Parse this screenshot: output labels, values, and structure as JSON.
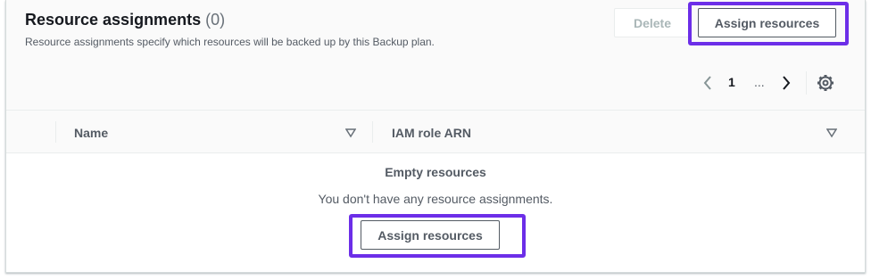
{
  "header": {
    "title": "Resource assignments",
    "count": "(0)",
    "description": "Resource assignments specify which resources will be backed up by this Backup plan.",
    "delete_label": "Delete",
    "assign_label": "Assign resources"
  },
  "pagination": {
    "current_page": "1",
    "ellipsis": "..."
  },
  "table": {
    "columns": [
      "Name",
      "IAM role ARN"
    ]
  },
  "empty_state": {
    "title": "Empty resources",
    "message": "You don't have any resource assignments.",
    "button_label": "Assign resources"
  },
  "colors": {
    "highlight": "#6c2ee8",
    "header_bg": "#fafafa"
  }
}
